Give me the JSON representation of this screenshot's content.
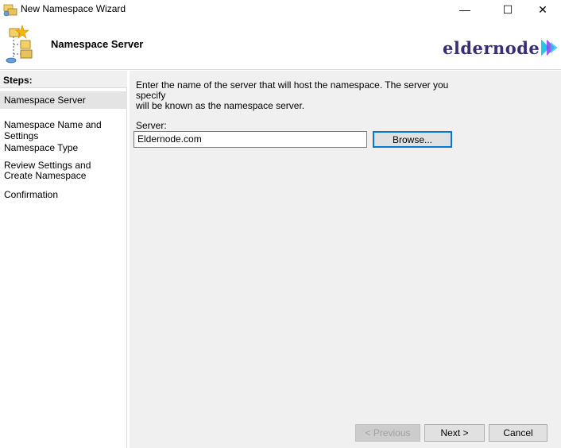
{
  "window": {
    "title": "New Namespace Wizard",
    "minimize_glyph": "—",
    "maximize_glyph": "☐",
    "close_glyph": "✕"
  },
  "header": {
    "title": "Namespace Server",
    "logo_text": "eldernode",
    "logo_colors": [
      "#3a2d78",
      "#27c6e6",
      "#8a3df0"
    ]
  },
  "sidebar": {
    "heading": "Steps:",
    "items": [
      {
        "label": "Namespace Server",
        "active": true
      },
      {
        "label": "Namespace Name and Settings",
        "active": false
      },
      {
        "label": "Namespace Type",
        "active": false
      },
      {
        "label": "Review Settings and Create Namespace",
        "active": false
      },
      {
        "label": "Confirmation",
        "active": false
      }
    ]
  },
  "main": {
    "intro_line1": "Enter the name of the server that will host the namespace. The server you specify",
    "intro_line2": "will be known as the namespace server.",
    "server_label": "Server:",
    "server_value": "Eldernode.com",
    "browse_label": "Browse..."
  },
  "footer": {
    "previous_label": "< Previous",
    "next_label": "Next >",
    "cancel_label": "Cancel"
  }
}
